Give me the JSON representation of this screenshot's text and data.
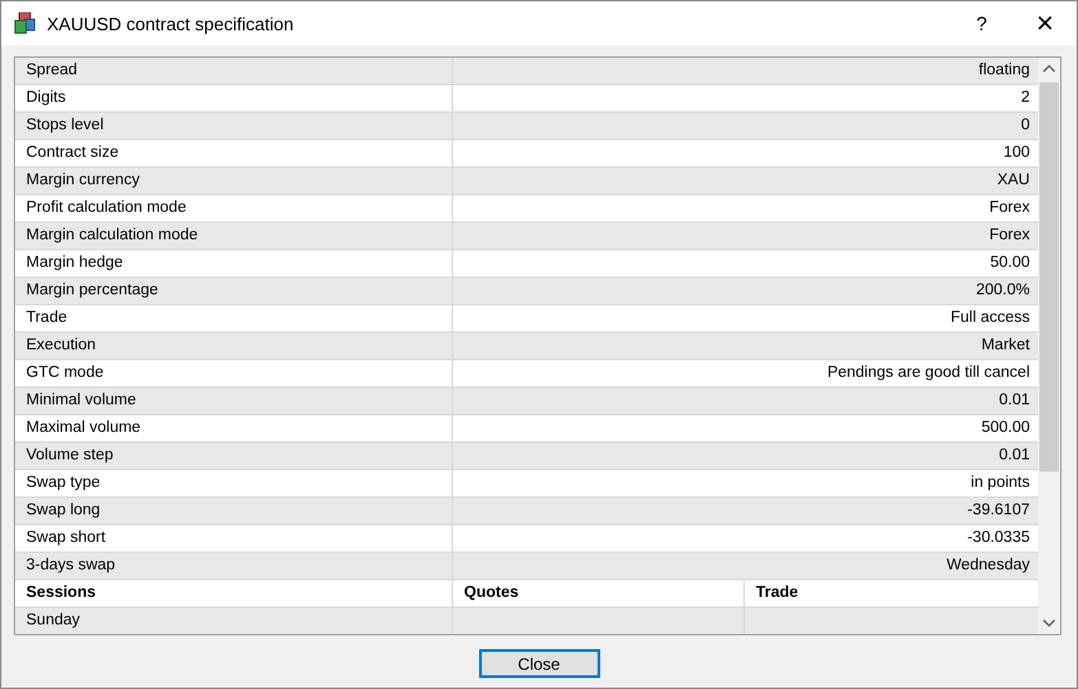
{
  "window": {
    "title": "XAUUSD contract specification",
    "help": "?",
    "close": "×"
  },
  "specs": [
    {
      "name": "Spread",
      "value": "floating"
    },
    {
      "name": "Digits",
      "value": "2"
    },
    {
      "name": "Stops level",
      "value": "0"
    },
    {
      "name": "Contract size",
      "value": "100"
    },
    {
      "name": "Margin currency",
      "value": "XAU"
    },
    {
      "name": "Profit calculation mode",
      "value": "Forex"
    },
    {
      "name": "Margin calculation mode",
      "value": "Forex"
    },
    {
      "name": "Margin hedge",
      "value": "50.00"
    },
    {
      "name": "Margin percentage",
      "value": "200.0%"
    },
    {
      "name": "Trade",
      "value": "Full access"
    },
    {
      "name": "Execution",
      "value": "Market"
    },
    {
      "name": "GTC mode",
      "value": "Pendings are good till cancel"
    },
    {
      "name": "Minimal volume",
      "value": "0.01"
    },
    {
      "name": "Maximal volume",
      "value": "500.00"
    },
    {
      "name": "Volume step",
      "value": "0.01"
    },
    {
      "name": "Swap type",
      "value": "in points"
    },
    {
      "name": "Swap long",
      "value": "-39.6107"
    },
    {
      "name": "Swap short",
      "value": "-30.0335"
    },
    {
      "name": "3-days swap",
      "value": "Wednesday"
    }
  ],
  "sessions": {
    "columns": [
      "Sessions",
      "Quotes",
      "Trade"
    ],
    "rows": [
      {
        "day": "Sunday"
      }
    ]
  },
  "buttons": [
    {
      "label": "Close",
      "focused": true
    }
  ]
}
